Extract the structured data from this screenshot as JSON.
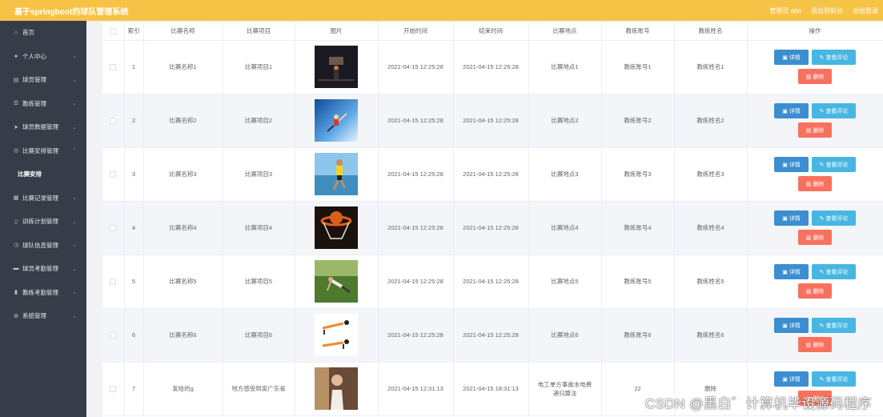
{
  "header": {
    "title": "基于springboot的球队管理系统",
    "user_label": "管理员 abo",
    "back_home": "退出到前台",
    "logout": "退出登录"
  },
  "sidebar": {
    "items": [
      {
        "label": "首页",
        "icon": "home-icon",
        "glyph": "⌂",
        "arrow": ""
      },
      {
        "label": "个人中心",
        "icon": "user-icon",
        "glyph": "●",
        "arrow": "⌄"
      },
      {
        "label": "球员管理",
        "icon": "players-icon",
        "glyph": "▤",
        "arrow": "⌄"
      },
      {
        "label": "教练管理",
        "icon": "coach-icon",
        "glyph": "☰",
        "arrow": "⌄"
      },
      {
        "label": "球员数据管理",
        "icon": "send-icon",
        "glyph": "➤",
        "arrow": "⌄"
      },
      {
        "label": "比赛安排管理",
        "icon": "location-icon",
        "glyph": "◎",
        "arrow": "⌃"
      },
      {
        "label": "比赛安排",
        "sub": true
      },
      {
        "label": "比赛记录管理",
        "icon": "chart-icon",
        "glyph": "▦",
        "arrow": "⌄"
      },
      {
        "label": "训练计划管理",
        "icon": "phone-icon",
        "glyph": "▯",
        "arrow": "⌄"
      },
      {
        "label": "球队信息管理",
        "icon": "clock-icon",
        "glyph": "◷",
        "arrow": "⌄"
      },
      {
        "label": "球员考勤管理",
        "icon": "card-icon",
        "glyph": "▬",
        "arrow": "⌄"
      },
      {
        "label": "教练考勤管理",
        "icon": "bars-icon",
        "glyph": "▮",
        "arrow": "⌄"
      },
      {
        "label": "系统管理",
        "icon": "settings-icon",
        "glyph": "⚙",
        "arrow": "⌄"
      }
    ]
  },
  "table": {
    "columns": [
      "索引",
      "比赛名称",
      "比赛项目",
      "图片",
      "开始时间",
      "结束时间",
      "比赛地点",
      "教练账号",
      "教练姓名",
      "操作"
    ],
    "buttons": {
      "detail": "详情",
      "review": "查看评论",
      "delete": "删除"
    },
    "rows": [
      {
        "index": "1",
        "name": "比赛名称1",
        "project": "比赛项目1",
        "image": "basketball-hoop-night",
        "start": "2021-04-15 12:25:28",
        "end": "2021-04-15 12:25:28",
        "place": "比赛地点1",
        "coach_account": "教练账号1",
        "coach_name": "教练姓名1"
      },
      {
        "index": "2",
        "name": "比赛名称2",
        "project": "比赛项目2",
        "image": "athlete-jump-sky",
        "start": "2021-04-15 12:25:28",
        "end": "2021-04-15 12:25:28",
        "place": "比赛地点2",
        "coach_account": "教练账号2",
        "coach_name": "教练姓名2"
      },
      {
        "index": "3",
        "name": "比赛名称3",
        "project": "比赛项目3",
        "image": "runner-seaside",
        "start": "2021-04-15 12:25:28",
        "end": "2021-04-15 12:25:28",
        "place": "比赛地点3",
        "coach_account": "教练账号3",
        "coach_name": "教练姓名3"
      },
      {
        "index": "4",
        "name": "比赛名称4",
        "project": "比赛项目4",
        "image": "basketball-net",
        "start": "2021-04-15 12:25:28",
        "end": "2021-04-15 12:25:28",
        "place": "比赛地点4",
        "coach_account": "教练账号4",
        "coach_name": "教练姓名4"
      },
      {
        "index": "5",
        "name": "比赛名称5",
        "project": "比赛项目5",
        "image": "grass-workout",
        "start": "2021-04-15 12:25:28",
        "end": "2021-04-15 12:25:28",
        "place": "比赛地点5",
        "coach_account": "教练账号5",
        "coach_name": "教练姓名5"
      },
      {
        "index": "6",
        "name": "比赛名称6",
        "project": "比赛项目6",
        "image": "pushup-poses",
        "start": "2021-04-15 12:25:28",
        "end": "2021-04-15 12:25:28",
        "place": "比赛地点6",
        "coach_account": "教练账号6",
        "coach_name": "教练姓名6"
      },
      {
        "index": "7",
        "name": "发给的g",
        "project": "地方感受到发广东省",
        "image": "person-photo",
        "start": "2021-04-15 12:31:13",
        "end": "2021-04-15 18:31:13",
        "place": "电工单方事故水电费递归算法",
        "coach_account": "22",
        "coach_name": "删除"
      }
    ]
  },
  "watermark": "CSDN @黑白゛计算机毕设源码程序"
}
